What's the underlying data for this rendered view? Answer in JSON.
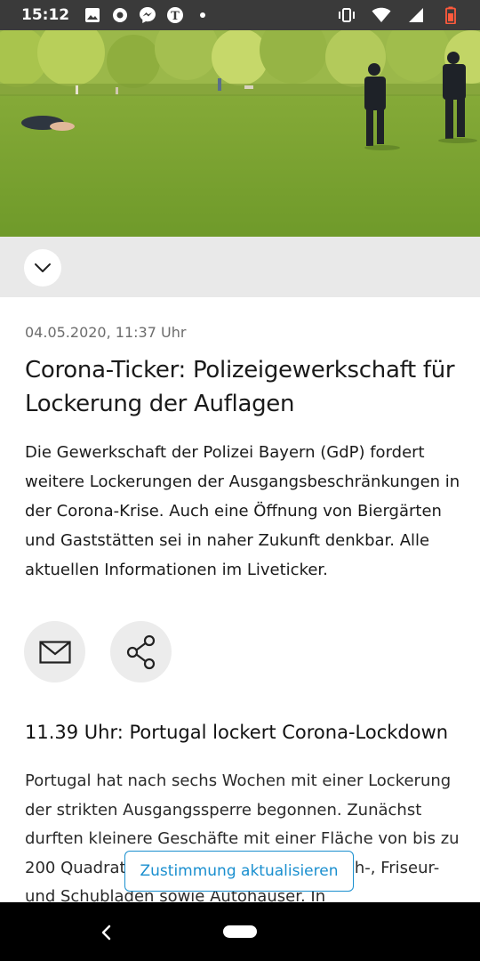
{
  "status_bar": {
    "time": "15:12",
    "icons": [
      "image-icon",
      "record-icon",
      "messenger-icon",
      "nyt-icon",
      "dot-icon",
      "vibrate-icon",
      "wifi-icon",
      "signal-icon",
      "battery-icon"
    ]
  },
  "hero": {
    "image": "park-police-photo"
  },
  "article": {
    "date": "04.05.2020, 11:37 Uhr",
    "headline": "Corona-Ticker: Polizeigewerkschaft für Lockerung der Auflagen",
    "lead": "Die Gewerkschaft der Polizei Bayern (GdP) fordert weitere Lockerungen der Ausgangsbeschränkungen in der Corona-Krise. Auch eine Öffnung von Biergärten und Gaststätten sei in naher Zukunft denkbar. Alle aktuellen Informationen im Liveticker.",
    "subhead": "11.39 Uhr: Portugal lockert Corona-Lockdown",
    "body": "Portugal hat nach sechs Wochen mit einer Lockerung der strikten Ausgangssperre begonnen. Zunächst durften kleinere Geschäfte mit einer Fläche von bis zu 200 Quadratmetern öffnen, darunter Buch-, Friseur- und Schubladen sowie Autohäuser. In"
  },
  "consent": {
    "label": "Zustimmung aktualisieren"
  },
  "colors": {
    "accent": "#1a8fcf",
    "status_bar": "#3a3a3a",
    "battery": "#ff5a3c"
  }
}
